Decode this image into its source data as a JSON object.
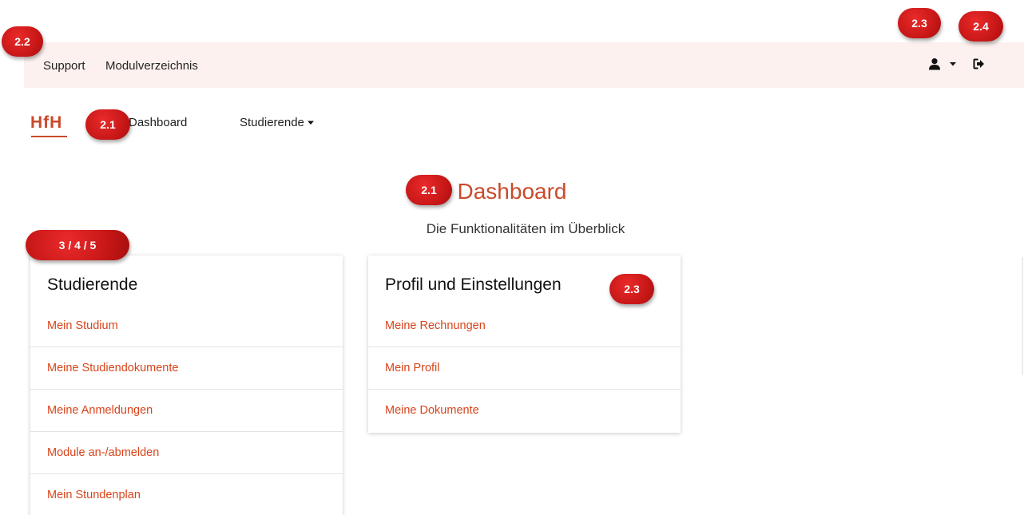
{
  "topbar": {
    "support": "Support",
    "modulverzeichnis": "Modulverzeichnis",
    "user_icon": "user-icon",
    "user_dropdown_icon": "caret-down-icon",
    "logout_icon": "sign-out-icon"
  },
  "nav": {
    "logo": "HfH",
    "dashboard": "Dashboard",
    "studierende": "Studierende",
    "studierende_dropdown_icon": "caret-down-icon"
  },
  "header": {
    "title": "Dashboard",
    "subtitle": "Die Funktionalitäten im Überblick"
  },
  "cards": {
    "studierende": {
      "title": "Studierende",
      "items": [
        "Mein Studium",
        "Meine Studiendokumente",
        "Meine Anmeldungen",
        "Module an-/abmelden",
        "Mein Stundenplan"
      ]
    },
    "profil": {
      "title": "Profil und Einstellungen",
      "items": [
        "Meine Rechnungen",
        "Mein Profil",
        "Meine Dokumente"
      ]
    }
  },
  "badges": {
    "support_area": "2.2",
    "nav_dashboard": "2.1",
    "page_title": "2.1",
    "student_cards": "3 / 4 / 5",
    "user_menu": "2.3",
    "logout": "2.4",
    "profile_card": "2.3"
  },
  "colors": {
    "accent": "#c94a2c",
    "link": "#d9441a",
    "topbar_bg": "#fcf1ef",
    "badge": "#d21b1b"
  }
}
